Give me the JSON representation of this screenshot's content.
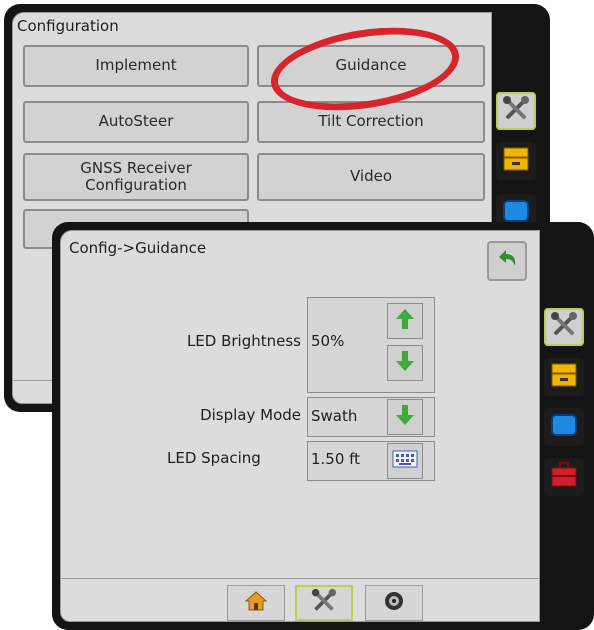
{
  "config_screen": {
    "title": "Configuration",
    "buttons": [
      {
        "label": "Implement"
      },
      {
        "label": "Guidance"
      },
      {
        "label": "AutoSteer"
      },
      {
        "label": "Tilt Correction"
      },
      {
        "label": "GNSS Receiver\nConfiguration"
      },
      {
        "label": "Video"
      }
    ],
    "side_tabs": [
      {
        "icon": "tools-icon",
        "active": true
      },
      {
        "icon": "data-drawer-icon",
        "active": false
      },
      {
        "icon": "console-display-icon",
        "active": false
      }
    ]
  },
  "guidance_screen": {
    "title": "Config->Guidance",
    "fields": [
      {
        "label": "LED Brightness",
        "value": "50%"
      },
      {
        "label": "Display Mode",
        "value": "Swath"
      },
      {
        "label": "LED Spacing",
        "value": "1.50 ft"
      }
    ],
    "side_tabs": [
      {
        "icon": "tools-icon",
        "active": true
      },
      {
        "icon": "data-drawer-icon",
        "active": false
      },
      {
        "icon": "console-display-icon",
        "active": false
      },
      {
        "icon": "toolbox-icon",
        "active": false
      }
    ],
    "bottom_tabs": [
      {
        "icon": "home-icon",
        "active": false
      },
      {
        "icon": "tools-icon",
        "active": true
      },
      {
        "icon": "camera-icon",
        "active": false
      }
    ]
  },
  "colors": {
    "highlight_ring": "#d8252b",
    "active_tab_border": "#b9d14a",
    "arrow_green": "#3eaa3e",
    "back_arrow_green": "#2f8f2f",
    "drawer_yellow": "#f0b400",
    "display_blue": "#1e88e5",
    "toolbox_red": "#d11f2a"
  }
}
